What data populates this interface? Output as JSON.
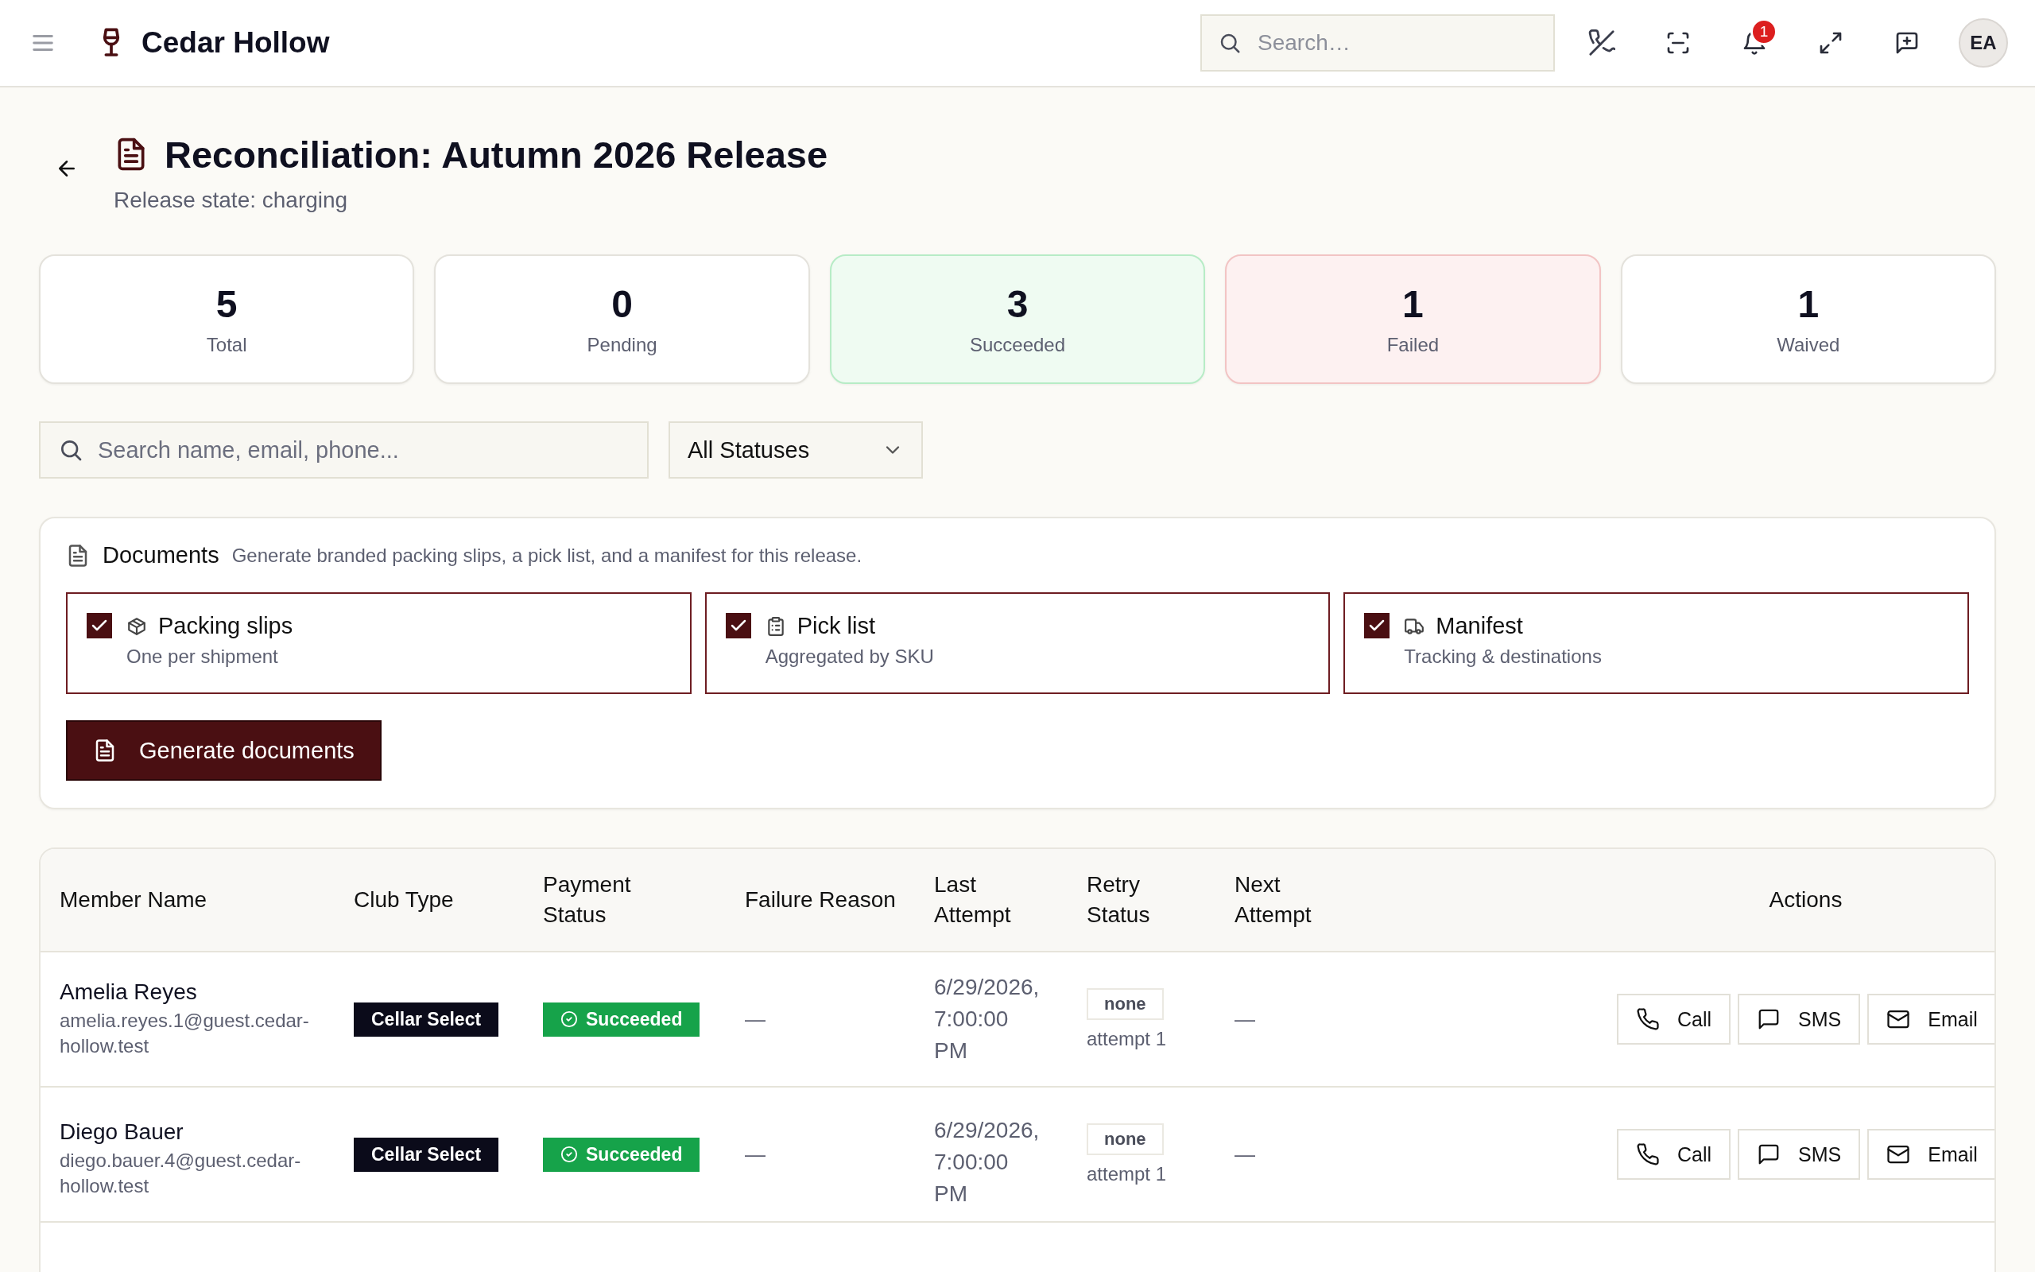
{
  "header": {
    "brand": "Cedar Hollow",
    "search": {
      "placeholder": "Search…"
    },
    "notifications": "1",
    "avatar": "EA"
  },
  "page": {
    "title": "Reconciliation: Autumn 2026 Release",
    "subtitle": "Release state: charging"
  },
  "stats": [
    {
      "value": "5",
      "label": "Total",
      "kind": "neutral"
    },
    {
      "value": "0",
      "label": "Pending",
      "kind": "neutral"
    },
    {
      "value": "3",
      "label": "Succeeded",
      "kind": "success"
    },
    {
      "value": "1",
      "label": "Failed",
      "kind": "danger"
    },
    {
      "value": "1",
      "label": "Waived",
      "kind": "neutral"
    }
  ],
  "filters": {
    "search": {
      "placeholder": "Search name, email, phone..."
    },
    "status": "All Statuses"
  },
  "documents": {
    "title": "Documents",
    "description": "Generate branded packing slips, a pick list, and a manifest for this release.",
    "options": [
      {
        "kind": "box",
        "label": "Packing slips",
        "hint": "One per shipment",
        "checked": true
      },
      {
        "kind": "clipboard",
        "label": "Pick list",
        "hint": "Aggregated by SKU",
        "checked": true
      },
      {
        "kind": "truck",
        "label": "Manifest",
        "hint": "Tracking & destinations",
        "checked": true
      }
    ],
    "button": "Generate documents"
  },
  "table": {
    "columns": [
      "Member Name",
      "Club Type",
      "Payment Status",
      "Failure Reason",
      "Last Attempt",
      "Retry Status",
      "Next Attempt",
      "Actions"
    ],
    "rows": [
      {
        "name": "Amelia Reyes",
        "email": "amelia.reyes.1@guest.cedar-hollow.test",
        "club": "Cellar Select",
        "payment": {
          "label": "Succeeded",
          "kind": "success"
        },
        "failure": "—",
        "last_attempt": "6/29/2026, 7:00:00 PM",
        "retry": "none",
        "attempt": "attempt 1",
        "next": "—",
        "actions": [
          {
            "kind": "call",
            "label": "Call"
          },
          {
            "kind": "sms",
            "label": "SMS"
          },
          {
            "kind": "email",
            "label": "Email"
          }
        ]
      },
      {
        "name": "Diego Bauer",
        "email": "diego.bauer.4@guest.cedar-hollow.test",
        "club": "Cellar Select",
        "payment": {
          "label": "Succeeded",
          "kind": "success"
        },
        "failure": "—",
        "last_attempt": "6/29/2026, 7:00:00 PM",
        "retry": "none",
        "attempt": "attempt 1",
        "next": "—",
        "actions": [
          {
            "kind": "call",
            "label": "Call"
          },
          {
            "kind": "sms",
            "label": "SMS"
          },
          {
            "kind": "email",
            "label": "Email"
          }
        ]
      }
    ]
  }
}
